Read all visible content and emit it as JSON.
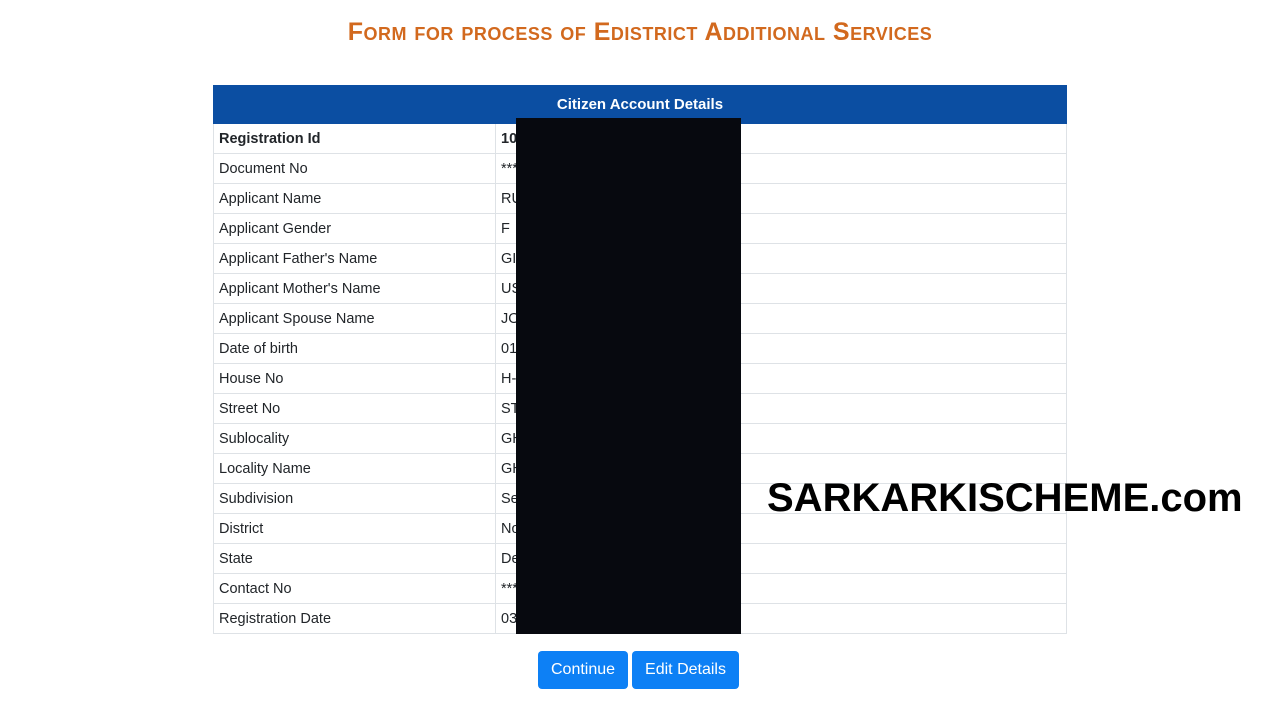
{
  "page": {
    "title": "Form for process of Edistrict Additional Services"
  },
  "table": {
    "header": "Citizen Account Details",
    "rows": [
      {
        "label": "Registration Id",
        "value": "10"
      },
      {
        "label": "Document No",
        "value": "***"
      },
      {
        "label": "Applicant Name",
        "value": "RU"
      },
      {
        "label": "Applicant Gender",
        "value": "F"
      },
      {
        "label": "Applicant Father's Name",
        "value": "GI"
      },
      {
        "label": "Applicant Mother's Name",
        "value": "US"
      },
      {
        "label": "Applicant Spouse Name",
        "value": "JO"
      },
      {
        "label": "Date of birth",
        "value": "01"
      },
      {
        "label": "House No",
        "value": "H-"
      },
      {
        "label": "Street No",
        "value": "ST"
      },
      {
        "label": "Sublocality",
        "value": "GH"
      },
      {
        "label": "Locality Name",
        "value": "GH"
      },
      {
        "label": "Subdivision",
        "value": "Se"
      },
      {
        "label": "District",
        "value": "No"
      },
      {
        "label": "State",
        "value": "De"
      },
      {
        "label": "Contact No",
        "value": "***"
      },
      {
        "label": "Registration Date",
        "value": "03"
      }
    ]
  },
  "buttons": {
    "continue_label": "Continue",
    "edit_label": "Edit Details"
  },
  "watermark": {
    "text": "SARKARKISCHEME.com"
  },
  "colors": {
    "title": "#d2691e",
    "header_bg": "#0b4ea2",
    "button_bg": "#0d80f5"
  }
}
